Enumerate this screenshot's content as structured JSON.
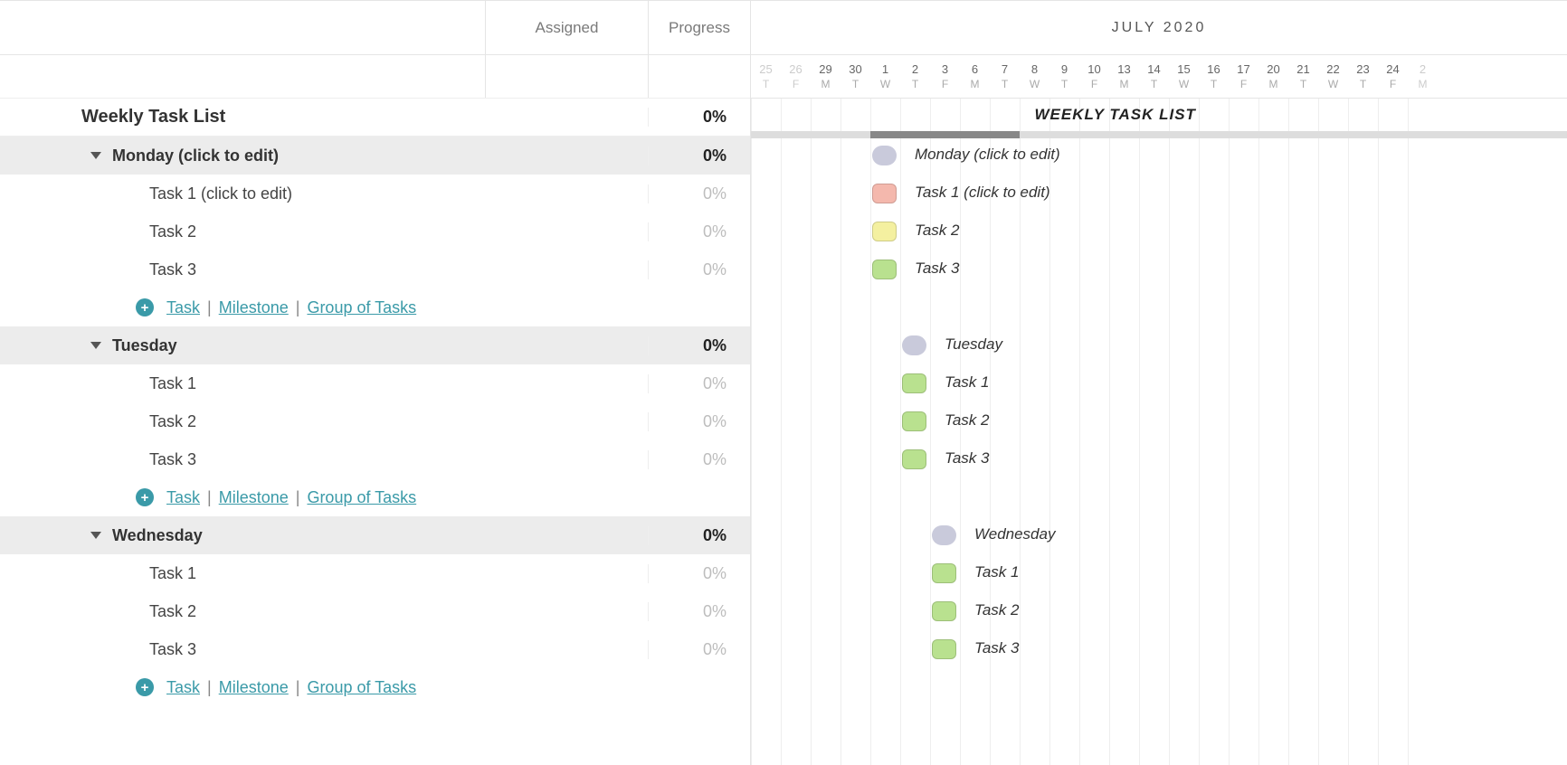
{
  "columns": {
    "assigned": "Assigned",
    "progress": "Progress"
  },
  "timeline": {
    "month_label": "JULY 2020",
    "dates": [
      {
        "n": "25",
        "d": "T",
        "fade": true
      },
      {
        "n": "26",
        "d": "F",
        "fade": true
      },
      {
        "n": "29",
        "d": "M"
      },
      {
        "n": "30",
        "d": "T"
      },
      {
        "n": "1",
        "d": "W"
      },
      {
        "n": "2",
        "d": "T"
      },
      {
        "n": "3",
        "d": "F"
      },
      {
        "n": "6",
        "d": "M"
      },
      {
        "n": "7",
        "d": "T"
      },
      {
        "n": "8",
        "d": "W"
      },
      {
        "n": "9",
        "d": "T"
      },
      {
        "n": "10",
        "d": "F"
      },
      {
        "n": "13",
        "d": "M"
      },
      {
        "n": "14",
        "d": "T"
      },
      {
        "n": "15",
        "d": "W"
      },
      {
        "n": "16",
        "d": "T"
      },
      {
        "n": "17",
        "d": "F"
      },
      {
        "n": "20",
        "d": "M"
      },
      {
        "n": "21",
        "d": "T"
      },
      {
        "n": "22",
        "d": "W"
      },
      {
        "n": "23",
        "d": "T"
      },
      {
        "n": "24",
        "d": "F"
      },
      {
        "n": "2",
        "d": "M",
        "fade": true
      }
    ],
    "project_label": "WEEKLY TASK LIST"
  },
  "project": {
    "name": "Weekly Task List",
    "progress": "0%"
  },
  "add_row": {
    "task": "Task",
    "milestone": "Milestone",
    "group": "Group of Tasks"
  },
  "groups": [
    {
      "name": "Monday (click to edit)",
      "progress": "0%",
      "bar_label": "Monday (click to edit)",
      "col": 4,
      "span": 1,
      "color": "#c9cadb",
      "tasks": [
        {
          "name": "Task 1 (click to edit)",
          "progress": "0%",
          "bar_label": "Task 1 (click to edit)",
          "col": 4,
          "span": 1,
          "color": "#f4b8ad"
        },
        {
          "name": "Task 2",
          "progress": "0%",
          "bar_label": "Task 2",
          "col": 4,
          "span": 1,
          "color": "#f4f0a0"
        },
        {
          "name": "Task 3",
          "progress": "0%",
          "bar_label": "Task 3",
          "col": 4,
          "span": 1,
          "color": "#b9e18f"
        }
      ]
    },
    {
      "name": "Tuesday",
      "progress": "0%",
      "bar_label": "Tuesday",
      "col": 5,
      "span": 1,
      "color": "#c9cadb",
      "tasks": [
        {
          "name": "Task 1",
          "progress": "0%",
          "bar_label": "Task 1",
          "col": 5,
          "span": 1,
          "color": "#b9e18f"
        },
        {
          "name": "Task 2",
          "progress": "0%",
          "bar_label": "Task 2",
          "col": 5,
          "span": 1,
          "color": "#b9e18f"
        },
        {
          "name": "Task 3",
          "progress": "0%",
          "bar_label": "Task 3",
          "col": 5,
          "span": 1,
          "color": "#b9e18f"
        }
      ]
    },
    {
      "name": "Wednesday",
      "progress": "0%",
      "bar_label": "Wednesday",
      "col": 6,
      "span": 1,
      "color": "#c9cadb",
      "tasks": [
        {
          "name": "Task 1",
          "progress": "0%",
          "bar_label": "Task 1",
          "col": 6,
          "span": 1,
          "color": "#b9e18f"
        },
        {
          "name": "Task 2",
          "progress": "0%",
          "bar_label": "Task 2",
          "col": 6,
          "span": 1,
          "color": "#b9e18f"
        },
        {
          "name": "Task 3",
          "progress": "0%",
          "bar_label": "Task 3",
          "col": 6,
          "span": 1,
          "color": "#b9e18f"
        }
      ]
    }
  ],
  "chart_data": {
    "type": "gantt",
    "title": "Weekly Task List",
    "month": "July 2020",
    "visible_dates": [
      "2020-06-25",
      "2020-06-26",
      "2020-06-29",
      "2020-06-30",
      "2020-07-01",
      "2020-07-02",
      "2020-07-03",
      "2020-07-06",
      "2020-07-07",
      "2020-07-08",
      "2020-07-09",
      "2020-07-10",
      "2020-07-13",
      "2020-07-14",
      "2020-07-15",
      "2020-07-16",
      "2020-07-17",
      "2020-07-20",
      "2020-07-21",
      "2020-07-22",
      "2020-07-23",
      "2020-07-24"
    ],
    "rows": [
      {
        "label": "Monday (click to edit)",
        "type": "group",
        "start": "2020-07-01",
        "end": "2020-07-01",
        "progress": 0
      },
      {
        "label": "Task 1 (click to edit)",
        "type": "task",
        "parent": "Monday",
        "start": "2020-07-01",
        "end": "2020-07-01",
        "progress": 0,
        "color": "red"
      },
      {
        "label": "Task 2",
        "type": "task",
        "parent": "Monday",
        "start": "2020-07-01",
        "end": "2020-07-01",
        "progress": 0,
        "color": "yellow"
      },
      {
        "label": "Task 3",
        "type": "task",
        "parent": "Monday",
        "start": "2020-07-01",
        "end": "2020-07-01",
        "progress": 0,
        "color": "green"
      },
      {
        "label": "Tuesday",
        "type": "group",
        "start": "2020-07-02",
        "end": "2020-07-02",
        "progress": 0
      },
      {
        "label": "Task 1",
        "type": "task",
        "parent": "Tuesday",
        "start": "2020-07-02",
        "end": "2020-07-02",
        "progress": 0,
        "color": "green"
      },
      {
        "label": "Task 2",
        "type": "task",
        "parent": "Tuesday",
        "start": "2020-07-02",
        "end": "2020-07-02",
        "progress": 0,
        "color": "green"
      },
      {
        "label": "Task 3",
        "type": "task",
        "parent": "Tuesday",
        "start": "2020-07-02",
        "end": "2020-07-02",
        "progress": 0,
        "color": "green"
      },
      {
        "label": "Wednesday",
        "type": "group",
        "start": "2020-07-03",
        "end": "2020-07-03",
        "progress": 0
      },
      {
        "label": "Task 1",
        "type": "task",
        "parent": "Wednesday",
        "start": "2020-07-03",
        "end": "2020-07-03",
        "progress": 0,
        "color": "green"
      },
      {
        "label": "Task 2",
        "type": "task",
        "parent": "Wednesday",
        "start": "2020-07-03",
        "end": "2020-07-03",
        "progress": 0,
        "color": "green"
      },
      {
        "label": "Task 3",
        "type": "task",
        "parent": "Wednesday",
        "start": "2020-07-03",
        "end": "2020-07-03",
        "progress": 0,
        "color": "green"
      }
    ]
  }
}
